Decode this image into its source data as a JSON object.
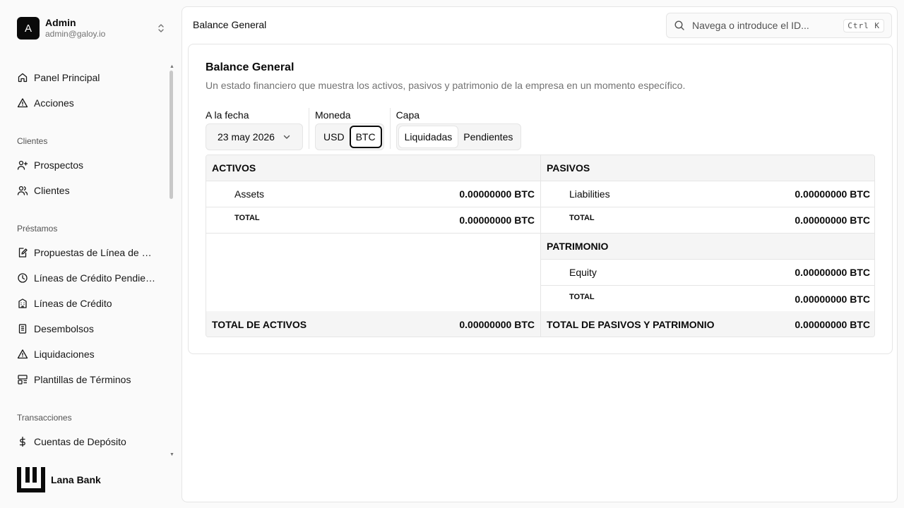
{
  "user": {
    "initial": "A",
    "name": "Admin",
    "email": "admin@galoy.io"
  },
  "nav": {
    "top": [
      {
        "label": "Panel Principal",
        "icon": "home-icon"
      },
      {
        "label": "Acciones",
        "icon": "alert-triangle-icon"
      }
    ],
    "groups": [
      {
        "label": "Clientes",
        "items": [
          {
            "label": "Prospectos",
            "icon": "user-plus-icon"
          },
          {
            "label": "Clientes",
            "icon": "users-icon"
          }
        ]
      },
      {
        "label": "Préstamos",
        "items": [
          {
            "label": "Propuestas de Línea de Cr...",
            "icon": "file-edit-icon"
          },
          {
            "label": "Líneas de Crédito Pendient...",
            "icon": "clock-icon"
          },
          {
            "label": "Líneas de Crédito",
            "icon": "landmark-icon"
          },
          {
            "label": "Desembolsos",
            "icon": "receipt-icon"
          },
          {
            "label": "Liquidaciones",
            "icon": "alert-triangle-icon"
          },
          {
            "label": "Plantillas de Términos",
            "icon": "template-icon"
          }
        ]
      },
      {
        "label": "Transacciones",
        "items": [
          {
            "label": "Cuentas de Depósito",
            "icon": "dollar-icon"
          }
        ]
      }
    ]
  },
  "brand": {
    "name": "Lana Bank"
  },
  "header": {
    "breadcrumb": "Balance General",
    "search_placeholder": "Navega o introduce el ID...",
    "search_shortcut": "Ctrl K"
  },
  "report": {
    "title": "Balance General",
    "description": "Un estado financiero que muestra los activos, pasivos y patrimonio de la empresa en un momento específico.",
    "date_label": "A la fecha",
    "date_value": "23 may 2026",
    "currency_label": "Moneda",
    "currency_options": [
      "USD",
      "BTC"
    ],
    "currency_selected": "BTC",
    "layer_label": "Capa",
    "layer_options": [
      "Liquidadas",
      "Pendientes"
    ],
    "layer_selected": "Liquidadas"
  },
  "sheet": {
    "assets": {
      "header": "ACTIVOS",
      "rows": [
        {
          "name": "Assets",
          "amount": "0.00000000 BTC"
        }
      ],
      "total_label": "TOTAL",
      "total_amount": "0.00000000 BTC"
    },
    "liabilities": {
      "header": "PASIVOS",
      "rows": [
        {
          "name": "Liabilities",
          "amount": "0.00000000 BTC"
        }
      ],
      "total_label": "TOTAL",
      "total_amount": "0.00000000 BTC"
    },
    "equity": {
      "header": "PATRIMONIO",
      "rows": [
        {
          "name": "Equity",
          "amount": "0.00000000 BTC"
        }
      ],
      "total_label": "TOTAL",
      "total_amount": "0.00000000 BTC"
    },
    "footer": {
      "assets_label": "TOTAL DE ACTIVOS",
      "assets_amount": "0.00000000 BTC",
      "liab_equity_label": "TOTAL DE PASIVOS Y PATRIMONIO",
      "liab_equity_amount": "0.00000000 BTC"
    }
  }
}
